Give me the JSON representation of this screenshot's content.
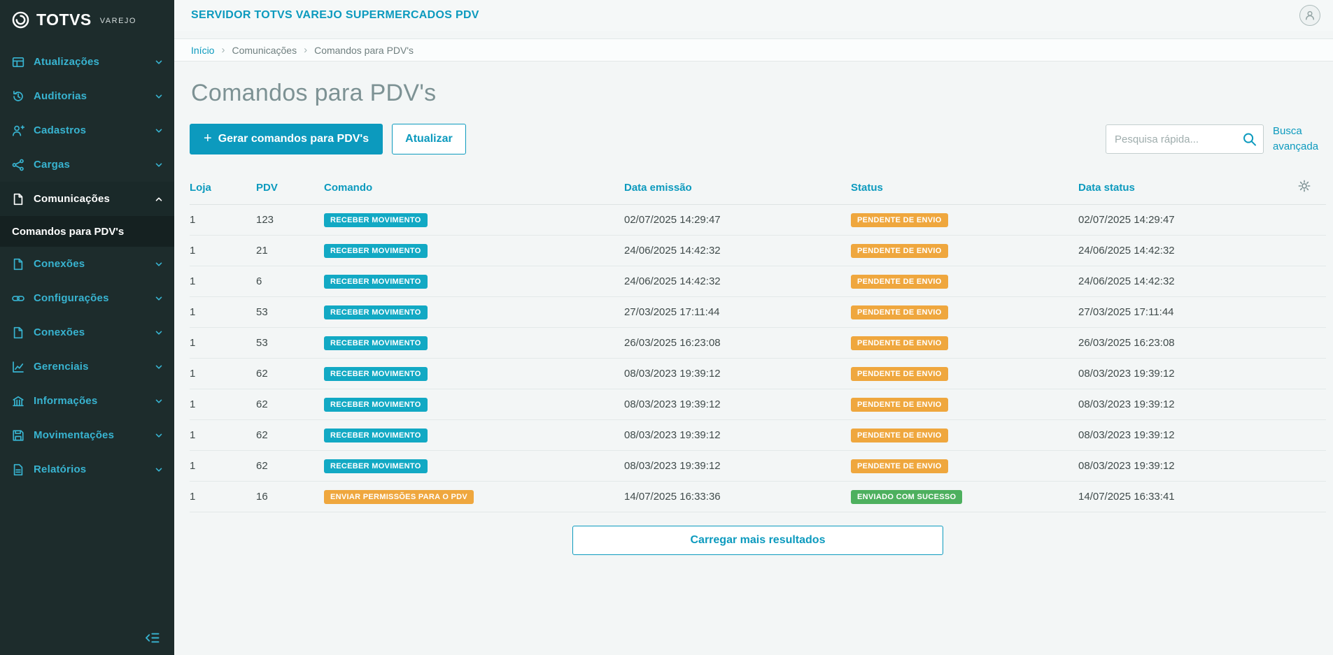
{
  "colors": {
    "primary": "#0c9abe",
    "sidebar_bg": "#1d2c2c",
    "menu_fg": "#38b4d1",
    "page_bg": "#f3f6f6",
    "badge_info": "#12a9c4",
    "badge_warning": "#efa73e",
    "badge_success": "#4db05e"
  },
  "brand": {
    "name": "TOTVS",
    "sub": "VAREJO",
    "logo_icon": "totvs-logo-icon"
  },
  "topbar": {
    "title": "SERVIDOR TOTVS VAREJO SUPERMERCADOS PDV",
    "avatar_icon": "user-icon"
  },
  "sidebar": {
    "items": [
      {
        "label": "Atualizações",
        "icon": "panels-icon",
        "state": "collapsed"
      },
      {
        "label": "Auditorias",
        "icon": "history-icon",
        "state": "collapsed"
      },
      {
        "label": "Cadastros",
        "icon": "user-add-icon",
        "state": "collapsed"
      },
      {
        "label": "Cargas",
        "icon": "share-icon",
        "state": "collapsed"
      },
      {
        "label": "Comunicações",
        "icon": "file-icon",
        "state": "expanded",
        "active": true,
        "children": [
          {
            "label": "Comandos para PDV's",
            "active": true
          }
        ]
      },
      {
        "label": "Conexões",
        "icon": "file-icon",
        "state": "collapsed"
      },
      {
        "label": "Configurações",
        "icon": "link-icon",
        "state": "collapsed"
      },
      {
        "label": "Conexões",
        "icon": "file-icon",
        "state": "collapsed"
      },
      {
        "label": "Gerenciais",
        "icon": "chart-icon",
        "state": "collapsed"
      },
      {
        "label": "Informações",
        "icon": "building-icon",
        "state": "collapsed"
      },
      {
        "label": "Movimentações",
        "icon": "save-icon",
        "state": "collapsed"
      },
      {
        "label": "Relatórios",
        "icon": "report-icon",
        "state": "collapsed"
      }
    ],
    "collapse_icon": "collapse-menu-icon"
  },
  "breadcrumb": [
    "Início",
    "Comunicações",
    "Comandos para PDV's"
  ],
  "page": {
    "title": "Comandos para PDV's"
  },
  "toolbar": {
    "generate_button": "Gerar comandos para PDV's",
    "refresh_button": "Atualizar",
    "search_placeholder": "Pesquisa rápida...",
    "advanced_search": "Busca avançada"
  },
  "table": {
    "columns": [
      "Loja",
      "PDV",
      "Comando",
      "Data emissão",
      "Status",
      "Data status"
    ],
    "settings_icon": "settings-gear-icon",
    "rows": [
      {
        "loja": "1",
        "pdv": "123",
        "comando": {
          "label": "RECEBER MOVIMENTO",
          "variant": "info"
        },
        "data_emissao": "02/07/2025 14:29:47",
        "status": {
          "label": "PENDENTE DE ENVIO",
          "variant": "warning"
        },
        "data_status": "02/07/2025 14:29:47"
      },
      {
        "loja": "1",
        "pdv": "21",
        "comando": {
          "label": "RECEBER MOVIMENTO",
          "variant": "info"
        },
        "data_emissao": "24/06/2025 14:42:32",
        "status": {
          "label": "PENDENTE DE ENVIO",
          "variant": "warning"
        },
        "data_status": "24/06/2025 14:42:32"
      },
      {
        "loja": "1",
        "pdv": "6",
        "comando": {
          "label": "RECEBER MOVIMENTO",
          "variant": "info"
        },
        "data_emissao": "24/06/2025 14:42:32",
        "status": {
          "label": "PENDENTE DE ENVIO",
          "variant": "warning"
        },
        "data_status": "24/06/2025 14:42:32"
      },
      {
        "loja": "1",
        "pdv": "53",
        "comando": {
          "label": "RECEBER MOVIMENTO",
          "variant": "info"
        },
        "data_emissao": "27/03/2025 17:11:44",
        "status": {
          "label": "PENDENTE DE ENVIO",
          "variant": "warning"
        },
        "data_status": "27/03/2025 17:11:44"
      },
      {
        "loja": "1",
        "pdv": "53",
        "comando": {
          "label": "RECEBER MOVIMENTO",
          "variant": "info"
        },
        "data_emissao": "26/03/2025 16:23:08",
        "status": {
          "label": "PENDENTE DE ENVIO",
          "variant": "warning"
        },
        "data_status": "26/03/2025 16:23:08"
      },
      {
        "loja": "1",
        "pdv": "62",
        "comando": {
          "label": "RECEBER MOVIMENTO",
          "variant": "info"
        },
        "data_emissao": "08/03/2023 19:39:12",
        "status": {
          "label": "PENDENTE DE ENVIO",
          "variant": "warning"
        },
        "data_status": "08/03/2023 19:39:12"
      },
      {
        "loja": "1",
        "pdv": "62",
        "comando": {
          "label": "RECEBER MOVIMENTO",
          "variant": "info"
        },
        "data_emissao": "08/03/2023 19:39:12",
        "status": {
          "label": "PENDENTE DE ENVIO",
          "variant": "warning"
        },
        "data_status": "08/03/2023 19:39:12"
      },
      {
        "loja": "1",
        "pdv": "62",
        "comando": {
          "label": "RECEBER MOVIMENTO",
          "variant": "info"
        },
        "data_emissao": "08/03/2023 19:39:12",
        "status": {
          "label": "PENDENTE DE ENVIO",
          "variant": "warning"
        },
        "data_status": "08/03/2023 19:39:12"
      },
      {
        "loja": "1",
        "pdv": "62",
        "comando": {
          "label": "RECEBER MOVIMENTO",
          "variant": "info"
        },
        "data_emissao": "08/03/2023 19:39:12",
        "status": {
          "label": "PENDENTE DE ENVIO",
          "variant": "warning"
        },
        "data_status": "08/03/2023 19:39:12"
      },
      {
        "loja": "1",
        "pdv": "16",
        "comando": {
          "label": "ENVIAR PERMISSÕES PARA O PDV",
          "variant": "warning"
        },
        "data_emissao": "14/07/2025 16:33:36",
        "status": {
          "label": "ENVIADO COM SUCESSO",
          "variant": "success"
        },
        "data_status": "14/07/2025 16:33:41"
      }
    ]
  },
  "load_more": "Carregar mais resultados"
}
